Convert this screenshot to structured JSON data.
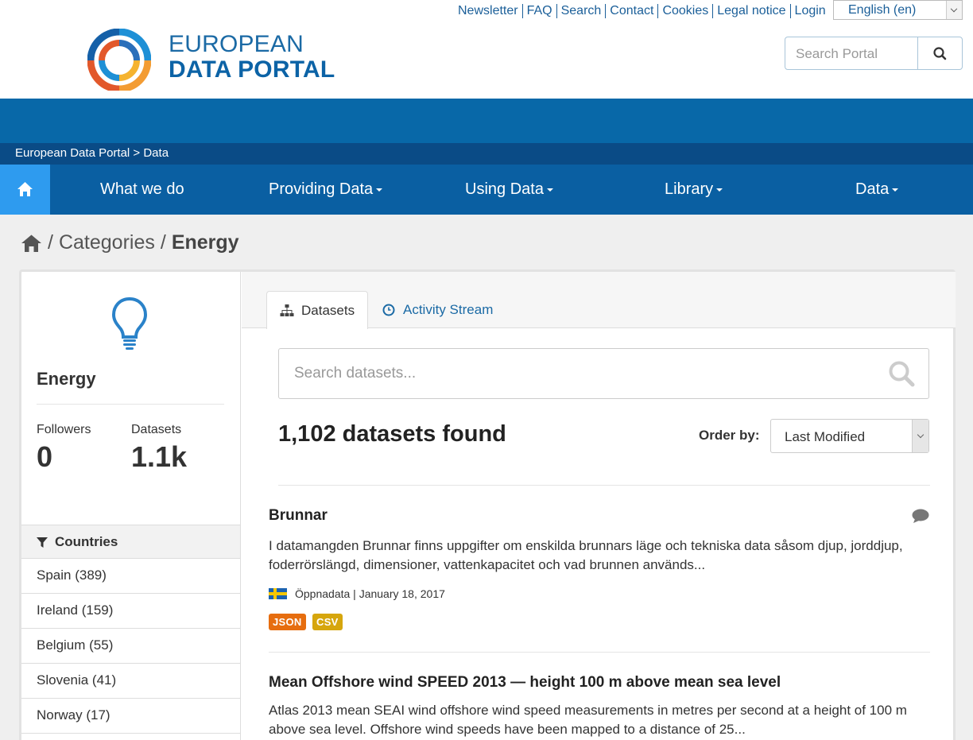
{
  "header": {
    "toplinks": [
      "Newsletter",
      "FAQ",
      "Search",
      "Contact",
      "Cookies",
      "Legal notice",
      "Login"
    ],
    "language": "English (en)",
    "brand_line1": "EUROPEAN",
    "brand_line2": "DATA PORTAL",
    "search_placeholder": "Search Portal"
  },
  "breadcrumb_bar": "European Data Portal > Data",
  "nav": {
    "items": [
      {
        "label": "What we do",
        "has_caret": false
      },
      {
        "label": "Providing Data",
        "has_caret": true
      },
      {
        "label": "Using Data",
        "has_caret": true
      },
      {
        "label": "Library",
        "has_caret": true
      },
      {
        "label": "Data",
        "has_caret": true
      }
    ]
  },
  "page_breadcrumb": {
    "sep": "/",
    "categories": "Categories",
    "current": "Energy"
  },
  "sidebar": {
    "title": "Energy",
    "followers_label": "Followers",
    "followers_value": "0",
    "datasets_label": "Datasets",
    "datasets_value": "1.1k",
    "facet_title": "Countries",
    "countries": [
      "Spain (389)",
      "Ireland (159)",
      "Belgium (55)",
      "Slovenia (41)",
      "Norway (17)"
    ]
  },
  "tabs": {
    "datasets": "Datasets",
    "activity": "Activity Stream"
  },
  "search": {
    "placeholder": "Search datasets..."
  },
  "results": {
    "count_text": "1,102 datasets found",
    "order_label": "Order by:",
    "order_value": "Last Modified"
  },
  "datasets": [
    {
      "title": "Brunnar",
      "description": "I datamangden Brunnar finns uppgifter om enskilda brunnars läge och tekniska data såsom djup, jorddjup, foderrörslängd, dimensioner, vattenkapacitet och vad brunnen används...",
      "publisher": "Öppnadata | January 18, 2017",
      "formats": [
        {
          "label": "JSON",
          "color": "#e66d0f"
        },
        {
          "label": "CSV",
          "color": "#d6a60d"
        }
      ]
    },
    {
      "title": "Mean Offshore wind SPEED 2013 — height 100 m above mean sea level",
      "description": "Atlas 2013 mean SEAI wind offshore wind speed measurements in metres per second at a height of 100 m above sea level. Offshore wind speeds have been mapped to a distance of 25..."
    }
  ],
  "colors": {
    "banner": "#0868a8",
    "crumb_bar": "#0a4b86",
    "nav": "#0a5fa2",
    "nav_home": "#2e9bef",
    "link": "#1b6aa5"
  }
}
